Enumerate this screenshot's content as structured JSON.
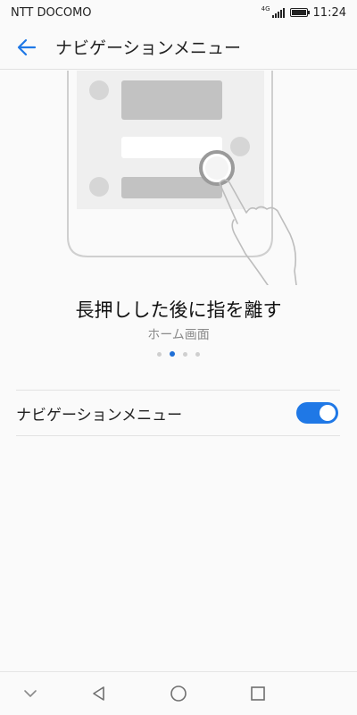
{
  "status_bar": {
    "carrier": "NTT DOCOMO",
    "network": "4G",
    "time": "11:24"
  },
  "app_bar": {
    "back_icon": "arrow-left-icon",
    "title": "ナビゲーションメニュー"
  },
  "tutorial": {
    "title": "長押しした後に指を離す",
    "subtitle": "ホーム画面",
    "page_count": 4,
    "current_page": 2
  },
  "setting": {
    "label": "ナビゲーションメニュー",
    "toggle_on": true
  },
  "nav_bar": {
    "buttons": [
      "chevron-down-icon",
      "back-triangle-icon",
      "home-circle-icon",
      "recents-square-icon"
    ]
  },
  "colors": {
    "accent": "#1f78e6",
    "pager_active": "#1f6fd6",
    "background": "#fafafa"
  }
}
